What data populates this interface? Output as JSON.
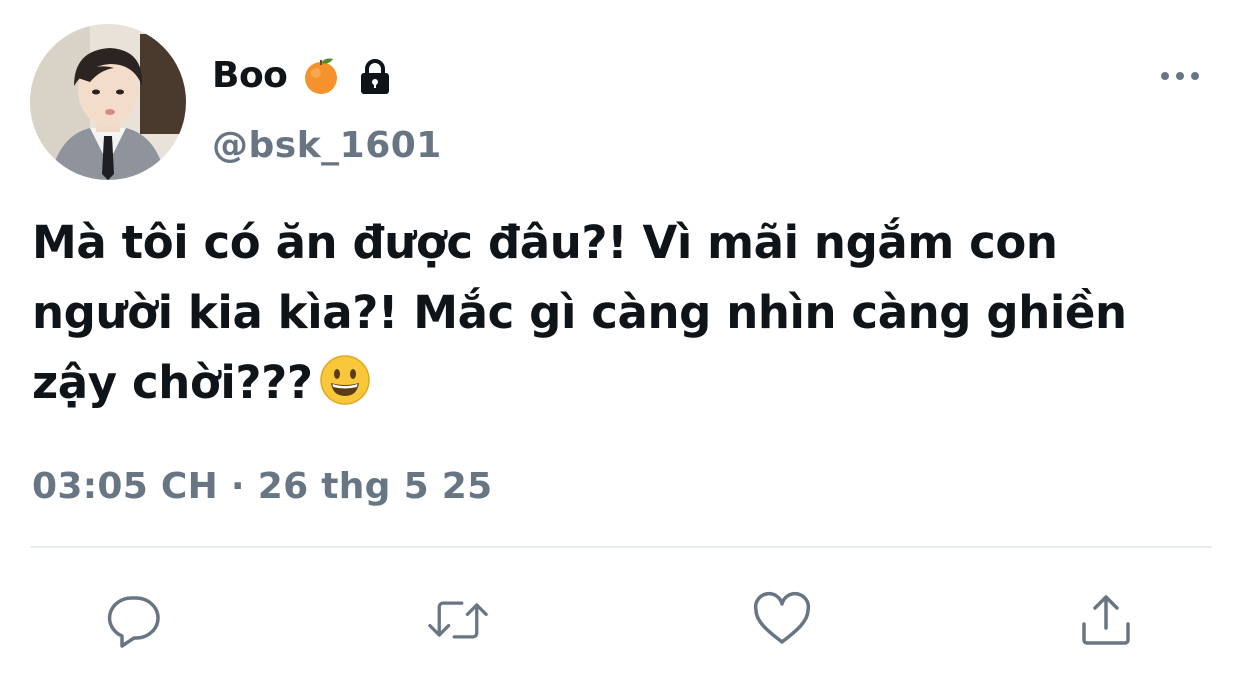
{
  "user": {
    "display_name": "Boo",
    "name_emoji": "orange-emoji",
    "protected_icon": "lock-icon",
    "handle": "@bsk_1601"
  },
  "tweet": {
    "text": "Mà tôi có ăn được đâu?! Vì mãi ngắm con người kia kìa?! Mắc gì càng nhìn càng ghiền zậy chời???",
    "trailing_emoji": "grinning-face-emoji",
    "timestamp": "03:05 CH · 26 thg 5 25"
  },
  "actions": [
    {
      "icon": "reply-icon"
    },
    {
      "icon": "retweet-icon"
    },
    {
      "icon": "like-icon"
    },
    {
      "icon": "share-icon"
    }
  ],
  "colors": {
    "text": "#0f1419",
    "secondary": "#687684",
    "divider": "#e6ecf0"
  }
}
